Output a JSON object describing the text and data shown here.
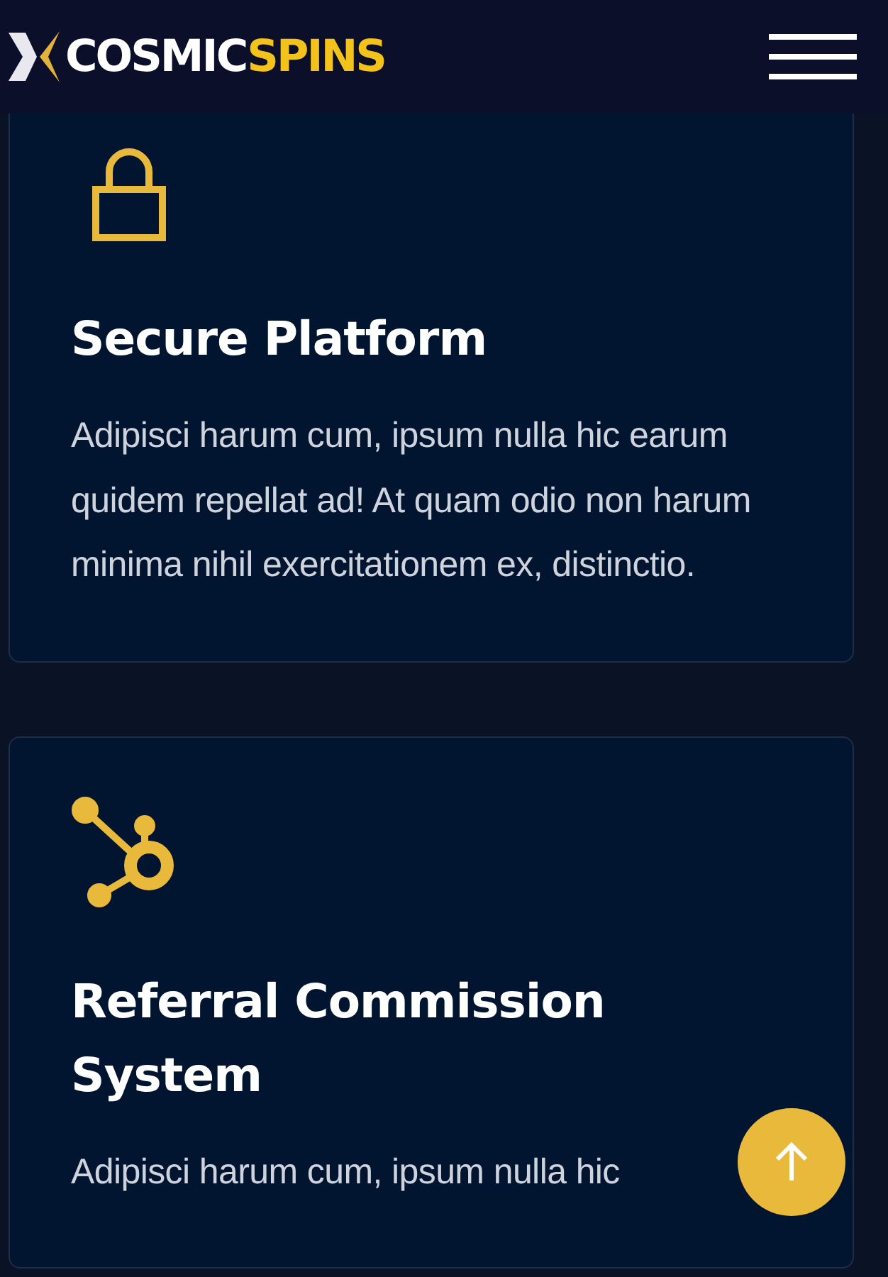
{
  "header": {
    "logo": {
      "word1": "COSMIC",
      "word2": "SPINS"
    }
  },
  "cards": [
    {
      "kind": "lock",
      "title": "Secure Platform",
      "text": "Adipisci harum cum, ipsum nulla hic earum quidem repellat ad! At quam odio non harum minima nihil exercitationem ex, distinctio."
    },
    {
      "kind": "hub",
      "title": "Referral Commission System",
      "text": "Adipisci harum cum, ipsum nulla hic"
    }
  ]
}
